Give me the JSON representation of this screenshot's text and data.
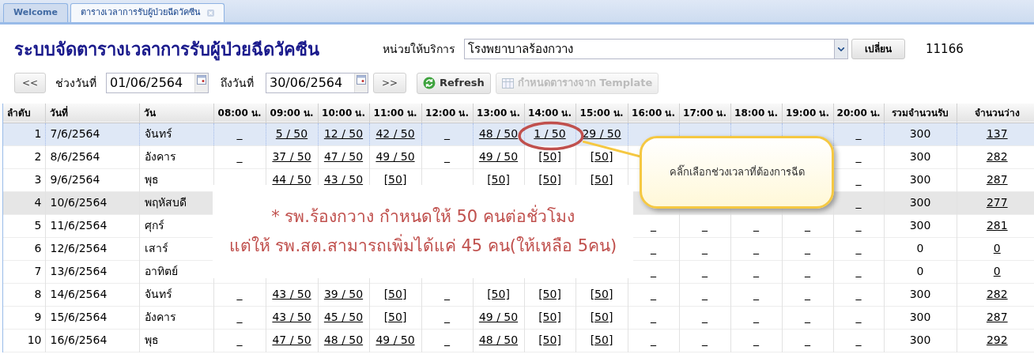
{
  "tabs": [
    {
      "label": "Welcome",
      "selected": false,
      "closable": false
    },
    {
      "label": "ตารางเวลาการรับผู้ป่วยฉีดวัคซีน",
      "selected": true,
      "closable": true
    }
  ],
  "title": "ระบบจัดตารางเวลาการรับผู้ป่วยฉีดวัคซีน",
  "unit": {
    "label": "หน่วยให้บริการ",
    "value": "โรงพยาบาลร้องกวาง",
    "button": "เปลี่ยน",
    "code": "11166"
  },
  "range": {
    "prev": "<<",
    "from_label": "ช่วงวันที่",
    "from": "01/06/2564",
    "to_label": "ถึงวันที่",
    "to": "30/06/2564",
    "next": ">>"
  },
  "toolbar": [
    {
      "label": "Refresh",
      "disabled": false
    },
    {
      "label": "กำหนดตารางจาก Template",
      "disabled": true
    }
  ],
  "table": {
    "columns": [
      "ลำดับ",
      "วันที่",
      "วัน",
      "08:00 น.",
      "09:00 น.",
      "10:00 น.",
      "11:00 น.",
      "12:00 น.",
      "13:00 น.",
      "14:00 น.",
      "15:00 น.",
      "16:00 น.",
      "17:00 น.",
      "18:00 น.",
      "19:00 น.",
      "20:00 น.",
      "รวมจำนวนรับ",
      "จำนวนว่าง"
    ],
    "rows": [
      {
        "no": "1",
        "date": "7/6/2564",
        "day": "จันทร์",
        "selected": true,
        "hovered": false,
        "slots": {
          "h08": {
            "text": "_",
            "link": false
          },
          "h09": {
            "text": "5 / 50",
            "link": true
          },
          "h10": {
            "text": "12 / 50",
            "link": true
          },
          "h11": {
            "text": "42 / 50",
            "link": true
          },
          "h12": {
            "text": "_",
            "link": false
          },
          "h13": {
            "text": "48 / 50",
            "link": true
          },
          "h14": {
            "text": "1 / 50",
            "link": true
          },
          "h15": {
            "text": "29 / 50",
            "link": true
          },
          "h20": {
            "text": "_",
            "link": false
          }
        },
        "total": "300",
        "free": "137"
      },
      {
        "no": "2",
        "date": "8/6/2564",
        "day": "อังคาร",
        "selected": false,
        "hovered": false,
        "slots": {
          "h08": {
            "text": "_",
            "link": false
          },
          "h09": {
            "text": "37 / 50",
            "link": true
          },
          "h10": {
            "text": "47 / 50",
            "link": true
          },
          "h11": {
            "text": "49 / 50",
            "link": true
          },
          "h12": {
            "text": "_",
            "link": false
          },
          "h13": {
            "text": "49 / 50",
            "link": true
          },
          "h14": {
            "text": "[50]",
            "link": true
          },
          "h15": {
            "text": "[50]",
            "link": true
          },
          "h20": {
            "text": "_",
            "link": false
          }
        },
        "total": "300",
        "free": "282"
      },
      {
        "no": "3",
        "date": "9/6/2564",
        "day": "พุธ",
        "selected": false,
        "hovered": false,
        "slots": {
          "h09": {
            "text": "44 / 50",
            "link": true
          },
          "h10": {
            "text": "43 / 50",
            "link": true
          },
          "h11": {
            "text": "[50]",
            "link": true
          },
          "h13": {
            "text": "[50]",
            "link": true
          },
          "h14": {
            "text": "[50]",
            "link": true
          },
          "h15": {
            "text": "[50]",
            "link": true
          },
          "h20": {
            "text": "_",
            "link": false
          }
        },
        "total": "300",
        "free": "287"
      },
      {
        "no": "4",
        "date": "10/6/2564",
        "day": "พฤหัสบดี",
        "selected": false,
        "hovered": true,
        "slots": {
          "h20": {
            "text": "_",
            "link": false
          }
        },
        "total": "300",
        "free": "277"
      },
      {
        "no": "5",
        "date": "11/6/2564",
        "day": "ศุกร์",
        "selected": false,
        "hovered": false,
        "slots": {
          "h16": {
            "text": "_",
            "link": false
          },
          "h17": {
            "text": "_",
            "link": false
          },
          "h18": {
            "text": "_",
            "link": false
          },
          "h19": {
            "text": "_",
            "link": false
          },
          "h20": {
            "text": "_",
            "link": false
          }
        },
        "total": "300",
        "free": "281"
      },
      {
        "no": "6",
        "date": "12/6/2564",
        "day": "เสาร์",
        "selected": false,
        "hovered": false,
        "slots": {
          "h16": {
            "text": "_",
            "link": false
          },
          "h17": {
            "text": "_",
            "link": false
          },
          "h18": {
            "text": "_",
            "link": false
          },
          "h19": {
            "text": "_",
            "link": false
          },
          "h20": {
            "text": "_",
            "link": false
          }
        },
        "total": "0",
        "free": "0"
      },
      {
        "no": "7",
        "date": "13/6/2564",
        "day": "อาทิตย์",
        "selected": false,
        "hovered": false,
        "slots": {
          "h16": {
            "text": "_",
            "link": false
          },
          "h17": {
            "text": "_",
            "link": false
          },
          "h18": {
            "text": "_",
            "link": false
          },
          "h19": {
            "text": "_",
            "link": false
          },
          "h20": {
            "text": "_",
            "link": false
          }
        },
        "total": "0",
        "free": "0"
      },
      {
        "no": "8",
        "date": "14/6/2564",
        "day": "จันทร์",
        "selected": false,
        "hovered": false,
        "slots": {
          "h08": {
            "text": "_",
            "link": false
          },
          "h09": {
            "text": "43 / 50",
            "link": true
          },
          "h10": {
            "text": "39 / 50",
            "link": true
          },
          "h11": {
            "text": "[50]",
            "link": true
          },
          "h12": {
            "text": "_",
            "link": false
          },
          "h13": {
            "text": "[50]",
            "link": true
          },
          "h14": {
            "text": "[50]",
            "link": true
          },
          "h15": {
            "text": "[50]",
            "link": true
          },
          "h16": {
            "text": "_",
            "link": false
          },
          "h17": {
            "text": "_",
            "link": false
          },
          "h18": {
            "text": "_",
            "link": false
          },
          "h19": {
            "text": "_",
            "link": false
          },
          "h20": {
            "text": "_",
            "link": false
          }
        },
        "total": "300",
        "free": "282"
      },
      {
        "no": "9",
        "date": "15/6/2564",
        "day": "อังคาร",
        "selected": false,
        "hovered": false,
        "slots": {
          "h08": {
            "text": "_",
            "link": false
          },
          "h09": {
            "text": "43 / 50",
            "link": true
          },
          "h10": {
            "text": "45 / 50",
            "link": true
          },
          "h11": {
            "text": "[50]",
            "link": true
          },
          "h12": {
            "text": "_",
            "link": false
          },
          "h13": {
            "text": "49 / 50",
            "link": true
          },
          "h14": {
            "text": "[50]",
            "link": true
          },
          "h15": {
            "text": "[50]",
            "link": true
          },
          "h16": {
            "text": "_",
            "link": false
          },
          "h17": {
            "text": "_",
            "link": false
          },
          "h18": {
            "text": "_",
            "link": false
          },
          "h19": {
            "text": "_",
            "link": false
          },
          "h20": {
            "text": "_",
            "link": false
          }
        },
        "total": "300",
        "free": "287"
      },
      {
        "no": "10",
        "date": "16/6/2564",
        "day": "พุธ",
        "selected": false,
        "hovered": false,
        "slots": {
          "h08": {
            "text": "_",
            "link": false
          },
          "h09": {
            "text": "47 / 50",
            "link": true
          },
          "h10": {
            "text": "48 / 50",
            "link": true
          },
          "h11": {
            "text": "49 / 50",
            "link": true
          },
          "h12": {
            "text": "_",
            "link": false
          },
          "h13": {
            "text": "48 / 50",
            "link": true
          },
          "h14": {
            "text": "[50]",
            "link": true
          },
          "h15": {
            "text": "[50]",
            "link": true
          },
          "h16": {
            "text": "_",
            "link": false
          },
          "h17": {
            "text": "_",
            "link": false
          },
          "h18": {
            "text": "_",
            "link": false
          },
          "h19": {
            "text": "_",
            "link": false
          },
          "h20": {
            "text": "_",
            "link": false
          }
        },
        "total": "300",
        "free": "292"
      }
    ]
  },
  "note": {
    "lines": [
      "* รพ.ร้องกวาง กำหนดให้ 50 คนต่อชั่วโมง",
      "แต่ให้ รพ.สต.สามารถเพิ่มได้แค่ 45 คน(ให้เหลือ 5คน)"
    ]
  },
  "callout": {
    "text": "คลิ๊กเลือกช่วงเวลาที่ต้องการฉีด"
  }
}
